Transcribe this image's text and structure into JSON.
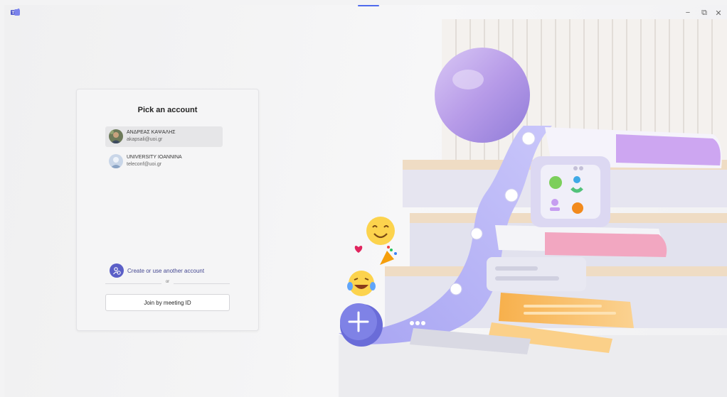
{
  "titlebar": {
    "min_glyph": "−",
    "restore_glyph": "⧉",
    "close_glyph": "✕"
  },
  "login": {
    "title": "Pick an account",
    "accounts": [
      {
        "name": "ΑΝΔΡΕΑΣ ΚΑΨΑΛΗΣ",
        "email": "akapsali@uoi.gr",
        "selected": true
      },
      {
        "name": "UNIVERSITY IOANNINA",
        "email": "teleconf@uoi.gr",
        "selected": false
      }
    ],
    "create_label": "Create or use another account",
    "or_label": "or",
    "join_label": "Join by meeting ID"
  },
  "colors": {
    "accent": "#5b5fc7",
    "link": "#444791",
    "indicator": "#4f6bed"
  },
  "icons": {
    "app": "teams-logo-icon",
    "create": "add-person-icon"
  }
}
